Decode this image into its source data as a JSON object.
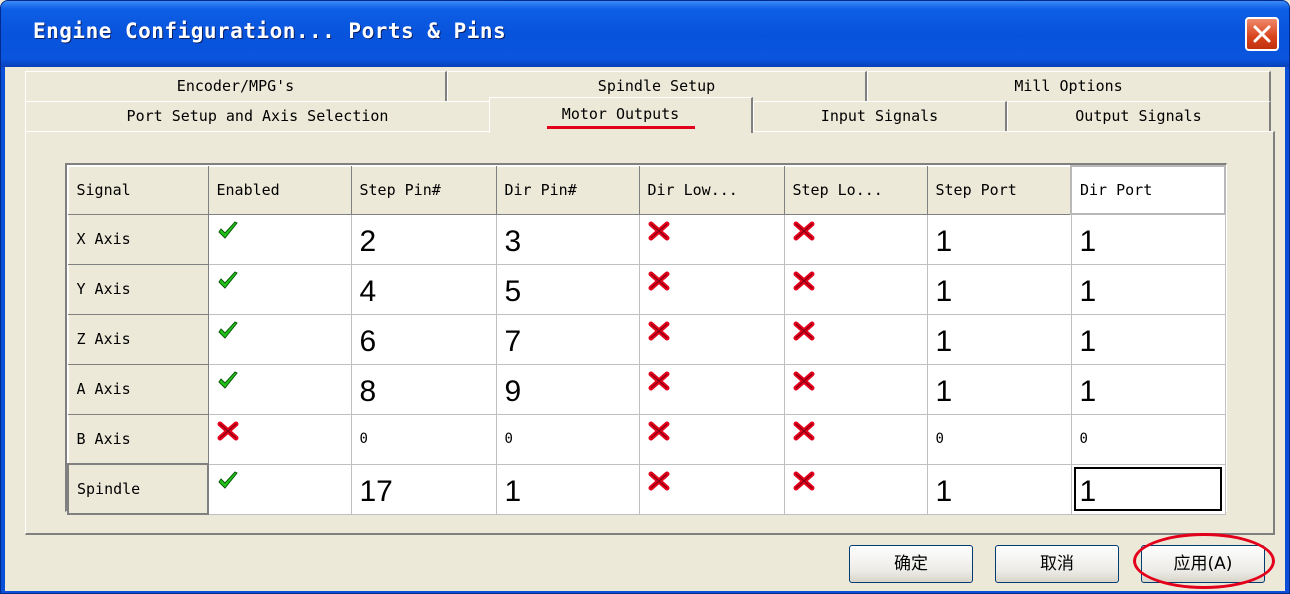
{
  "window": {
    "title": "Engine Configuration... Ports & Pins"
  },
  "tabs": {
    "row1": [
      {
        "label": "Encoder/MPG's"
      },
      {
        "label": "Spindle Setup"
      },
      {
        "label": "Mill Options"
      }
    ],
    "row2": [
      {
        "label": "Port Setup and Axis Selection"
      },
      {
        "label": "Motor Outputs",
        "active": true
      },
      {
        "label": "Input Signals"
      },
      {
        "label": "Output Signals"
      }
    ]
  },
  "table": {
    "headers": [
      "Signal",
      "Enabled",
      "Step Pin#",
      "Dir Pin#",
      "Dir Low...",
      "Step Lo...",
      "Step Port",
      "Dir Port"
    ],
    "rows": [
      {
        "signal": "X Axis",
        "enabled": "check",
        "step_pin": "2",
        "dir_pin": "3",
        "dir_low": "x",
        "step_low": "x",
        "step_port": "1",
        "dir_port": "1"
      },
      {
        "signal": "Y Axis",
        "enabled": "check",
        "step_pin": "4",
        "dir_pin": "5",
        "dir_low": "x",
        "step_low": "x",
        "step_port": "1",
        "dir_port": "1"
      },
      {
        "signal": "Z Axis",
        "enabled": "check",
        "step_pin": "6",
        "dir_pin": "7",
        "dir_low": "x",
        "step_low": "x",
        "step_port": "1",
        "dir_port": "1"
      },
      {
        "signal": "A Axis",
        "enabled": "check",
        "step_pin": "8",
        "dir_pin": "9",
        "dir_low": "x",
        "step_low": "x",
        "step_port": "1",
        "dir_port": "1"
      },
      {
        "signal": "B Axis",
        "enabled": "x",
        "step_pin": "0",
        "dir_pin": "0",
        "dir_low": "x",
        "step_low": "x",
        "step_port": "0",
        "dir_port": "0"
      },
      {
        "signal": "Spindle",
        "enabled": "check",
        "step_pin": "17",
        "dir_pin": "1",
        "dir_low": "x",
        "step_low": "x",
        "step_port": "1",
        "dir_port": "1"
      }
    ]
  },
  "buttons": {
    "ok": "确定",
    "cancel": "取消",
    "apply": "应用(A)"
  },
  "colors": {
    "check": "#22c41a",
    "cross": "#e3001b",
    "annotation": "#e3001b"
  }
}
